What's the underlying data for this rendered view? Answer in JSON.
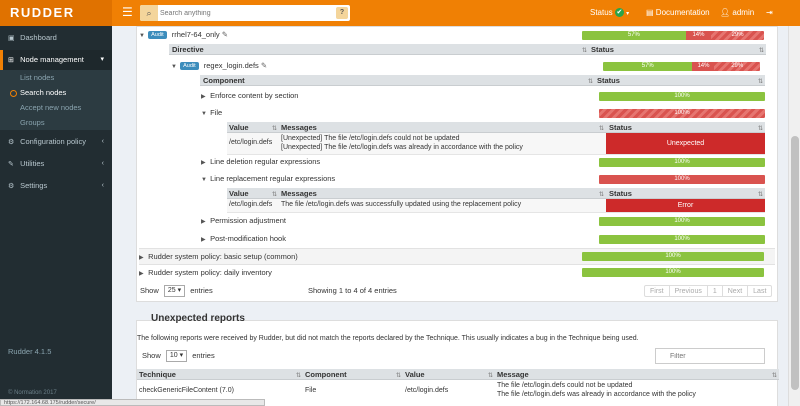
{
  "brand": {
    "logo": "RUDDER",
    "version": "Rudder 4.1.5",
    "copyright": "© Normation 2017"
  },
  "topbar": {
    "search_placeholder": "Search anything",
    "help": "?",
    "status_label": "Status",
    "status_check": "✔",
    "documentation": "Documentation",
    "user": "admin"
  },
  "sidebar": {
    "dashboard": "Dashboard",
    "node_management": "Node management",
    "sub": {
      "list": "List nodes",
      "search": "Search nodes",
      "accept": "Accept new nodes",
      "groups": "Groups"
    },
    "config_policy": "Configuration policy",
    "utilities": "Utilities",
    "settings": "Settings"
  },
  "url": "https://172.164.68.175/rudder/secure/",
  "compliance": {
    "audit_badge": "Audit",
    "rule_name": "rrhel7-64_only",
    "directive_header": "Directive",
    "status_header": "Status",
    "directive_name": "regex_login.defs",
    "component_header": "Component",
    "value_header": "Value",
    "messages_header": "Messages",
    "rule_bar": {
      "green": "57%",
      "red": "14%",
      "red2": "29%"
    },
    "directive_bar": {
      "green": "57%",
      "red": "14%",
      "red2": "29%"
    },
    "components": [
      {
        "name": "Enforce content by section",
        "pct": "100%"
      },
      {
        "name": "File",
        "pct": "100%"
      },
      {
        "name": "Line deletion regular expressions",
        "pct": "100%"
      },
      {
        "name": "Line replacement regular expressions",
        "pct": "100%"
      },
      {
        "name": "Permission adjustment",
        "pct": "100%"
      },
      {
        "name": "Post-modification hook",
        "pct": "100%"
      }
    ],
    "file_value": "/etc/login.defs",
    "file_msg1": "[Unexpected] The file /etc/login.defs could not be updated",
    "file_msg2": "[Unexpected] The file /etc/login.defs was already in accordance with the policy",
    "file_status": "Unexpected",
    "repl_value": "/etc/login.defs",
    "repl_msg": "The file /etc/login.defs was successfully updated using the replacement policy",
    "repl_status": "Error",
    "system_rules": [
      {
        "name": "Rudder system policy: basic setup (common)",
        "pct": "100%"
      },
      {
        "name": "Rudder system policy: daily inventory",
        "pct": "100%"
      }
    ],
    "show": "Show",
    "show_value": "25",
    "entries": "entries",
    "showing": "Showing 1 to 4 of 4 entries",
    "pager": [
      "First",
      "Previous",
      "1",
      "Next",
      "Last"
    ]
  },
  "unexpected": {
    "title": "Unexpected reports",
    "desc": "The following reports were received by Rudder, but did not match the reports declared by the Technique. This usually indicates a bug in the Technique being used.",
    "show": "Show",
    "show_value": "10",
    "entries": "entries",
    "filter_placeholder": "Filter",
    "headers": [
      "Technique",
      "Component",
      "Value",
      "Message"
    ],
    "row": {
      "technique": "checkGenericFileContent (7.0)",
      "component": "File",
      "value": "/etc/login.defs",
      "msg1": "The file /etc/login.defs could not be updated",
      "msg2": "The file /etc/login.defs was already in accordance with the policy"
    }
  },
  "colors": {
    "orange": "#f08004",
    "green": "#8bc33f",
    "red": "#d9534f",
    "sidebar": "#222d32"
  }
}
